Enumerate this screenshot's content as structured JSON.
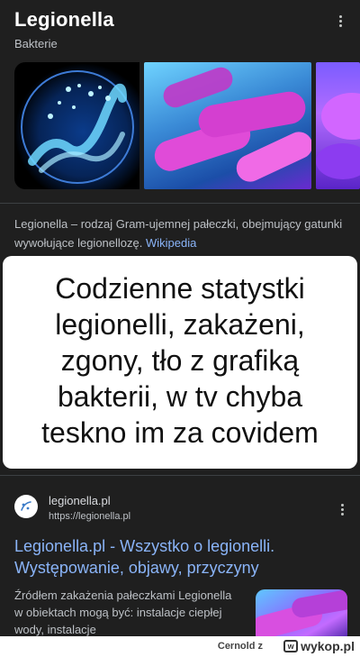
{
  "knowledge_panel": {
    "title": "Legionella",
    "subtitle": "Bakterie",
    "images": [
      {
        "description_icon": "petri-dish-image"
      },
      {
        "description_icon": "bacteria-3d-image"
      },
      {
        "description_icon": "bacteria-closeup-image"
      }
    ],
    "description": "Legionella – rodzaj Gram-ujemnej pałeczki, obejmujący gatunki wywołujące legionellozę.",
    "source_link": "Wikipedia"
  },
  "meme_caption": "Codzienne statystki legionelli, zakażeni, zgony, tło z grafiką bakterii, w tv chyba teskno im za covidem",
  "search_result": {
    "site_name": "legionella.pl",
    "site_url": "https://legionella.pl",
    "title": "Legionella.pl - Wszystko o legionelli. Występowanie, objawy, przyczyny",
    "snippet": "Źródłem zakażenia pałeczkami Legionella w obiektach mogą być: instalacje ciepłej wody, instalacje"
  },
  "footer": {
    "username": "Cernold",
    "separator": "z",
    "brand": "wykop.pl"
  },
  "colors": {
    "background": "#1f1f1f",
    "link": "#8ab4f8",
    "text_secondary": "#bdc1c6"
  }
}
